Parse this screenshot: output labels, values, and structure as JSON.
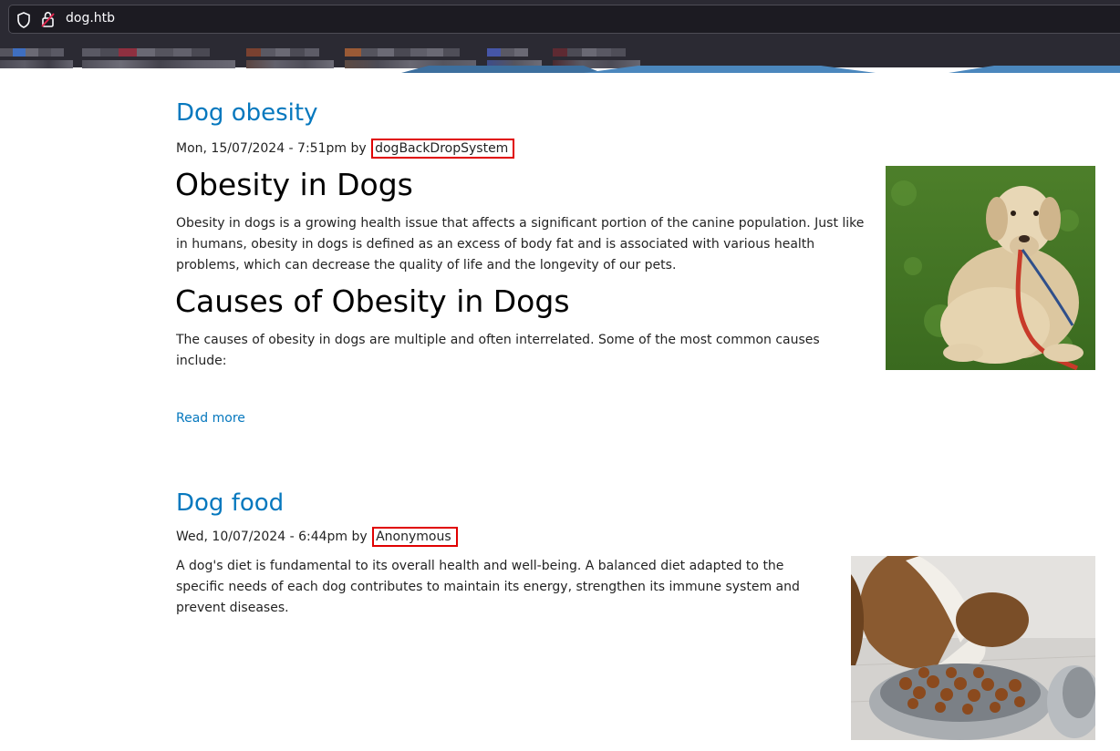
{
  "browser": {
    "url": "dog.htb"
  },
  "posts": [
    {
      "title": "Dog obesity",
      "meta_prefix": "Mon, 15/07/2024 - 7:51pm by",
      "author": "dogBackDropSystem",
      "heading1": "Obesity in Dogs",
      "para1": "Obesity in dogs is a growing health issue that affects a significant portion of the canine population. Just like in humans, obesity in dogs is defined as an excess of body fat and is associated with various health problems, which can decrease the quality of life and the longevity of our pets.",
      "heading2": "Causes of Obesity in Dogs",
      "para2": "The causes of obesity in dogs are multiple and often interrelated. Some of the most common causes include:",
      "read_more": "Read more"
    },
    {
      "title": "Dog food",
      "meta_prefix": "Wed, 10/07/2024 - 6:44pm by",
      "author": "Anonymous",
      "para1": "A dog's diet is fundamental to its overall health and well-being. A balanced diet adapted to the specific needs of each dog contributes to maintain its energy, strengthen its immune system and prevent diseases."
    }
  ],
  "colors": {
    "link": "#0678be",
    "highlight_border": "#e00000",
    "chrome_bg": "#2b2a33"
  }
}
